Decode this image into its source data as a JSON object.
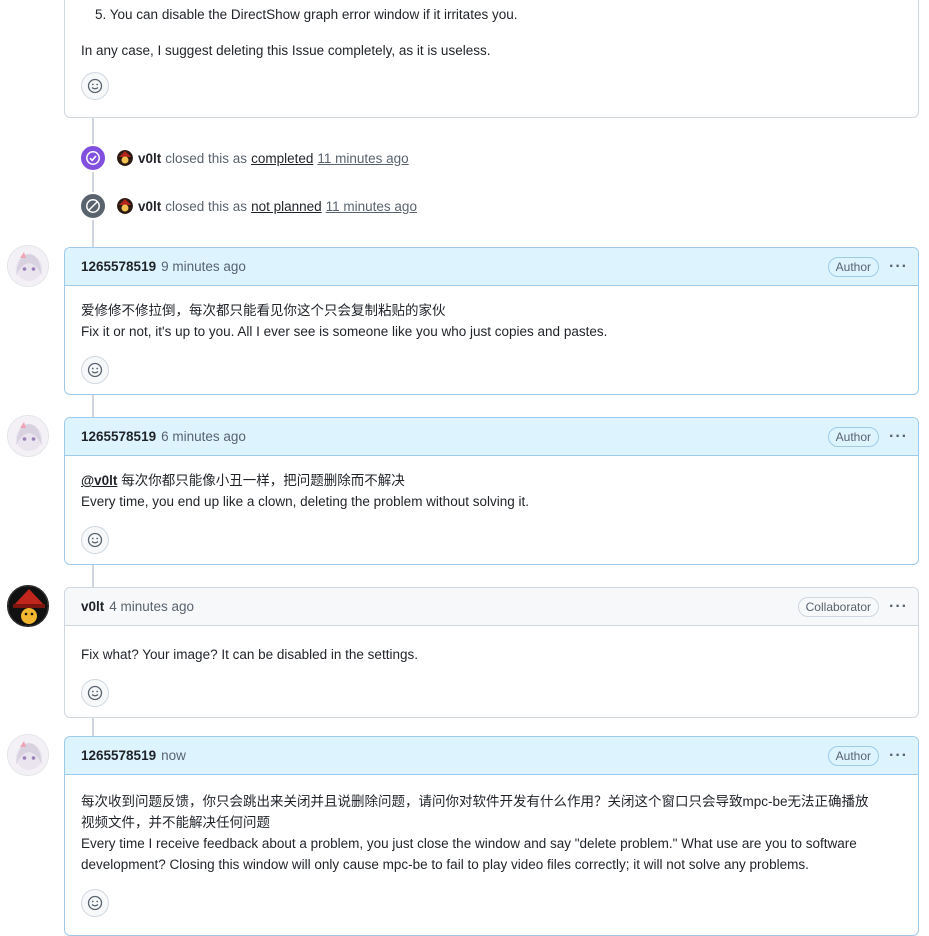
{
  "top_comment": {
    "list_item": "5. You can disable the DirectShow graph error window if it irritates you.",
    "paragraph": "In any case, I suggest deleting this Issue completely, as it is useless."
  },
  "events": [
    {
      "actor": "v0lt",
      "pre": "closed this as",
      "link": "completed",
      "time": "11 minutes ago",
      "badge_color": "#8250df"
    },
    {
      "actor": "v0lt",
      "pre": "closed this as",
      "link": "not planned",
      "time": "11 minutes ago",
      "badge_color": "#59636e"
    }
  ],
  "comments": [
    {
      "author": "1265578519",
      "time": "9 minutes ago",
      "role": "Author",
      "lines": [
        "爱修修不修拉倒，每次都只能看见你这个只会复制粘贴的家伙",
        "Fix it or not, it's up to you. All I ever see is someone like you who just copies and pastes."
      ]
    },
    {
      "author": "1265578519",
      "time": "6 minutes ago",
      "role": "Author",
      "mention": "@v0lt",
      "lines": [
        "每次你都只能像小丑一样，把问题删除而不解决",
        "Every time, you end up like a clown, deleting the problem without solving it."
      ]
    },
    {
      "author": "v0lt",
      "time": "4 minutes ago",
      "role": "Collaborator",
      "lines": [
        "Fix what? Your image? It can be disabled in the settings."
      ]
    },
    {
      "author": "1265578519",
      "time": "now",
      "role": "Author",
      "lines": [
        "每次收到问题反馈，你只会跳出来关闭并且说删除问题，请问你对软件开发有什么作用？关闭这个窗口只会导致mpc-be无法正确播放",
        "视频文件，并不能解决任何问题",
        "Every time I receive feedback about a problem, you just close the window and say \"delete problem.\" What use are you to software",
        "development? Closing this window will only cause mpc-be to fail to play video files correctly; it will not solve any problems."
      ]
    }
  ],
  "icons": {
    "reaction": "smiley-icon",
    "completed": "check-circle-icon",
    "not_planned": "skip-circle-icon",
    "more": "kebab-horizontal-icon"
  },
  "colors": {
    "author_header": "#ddf4ff",
    "author_border": "#9ecbe9",
    "completed": "#8250df",
    "not_planned": "#59636e"
  }
}
